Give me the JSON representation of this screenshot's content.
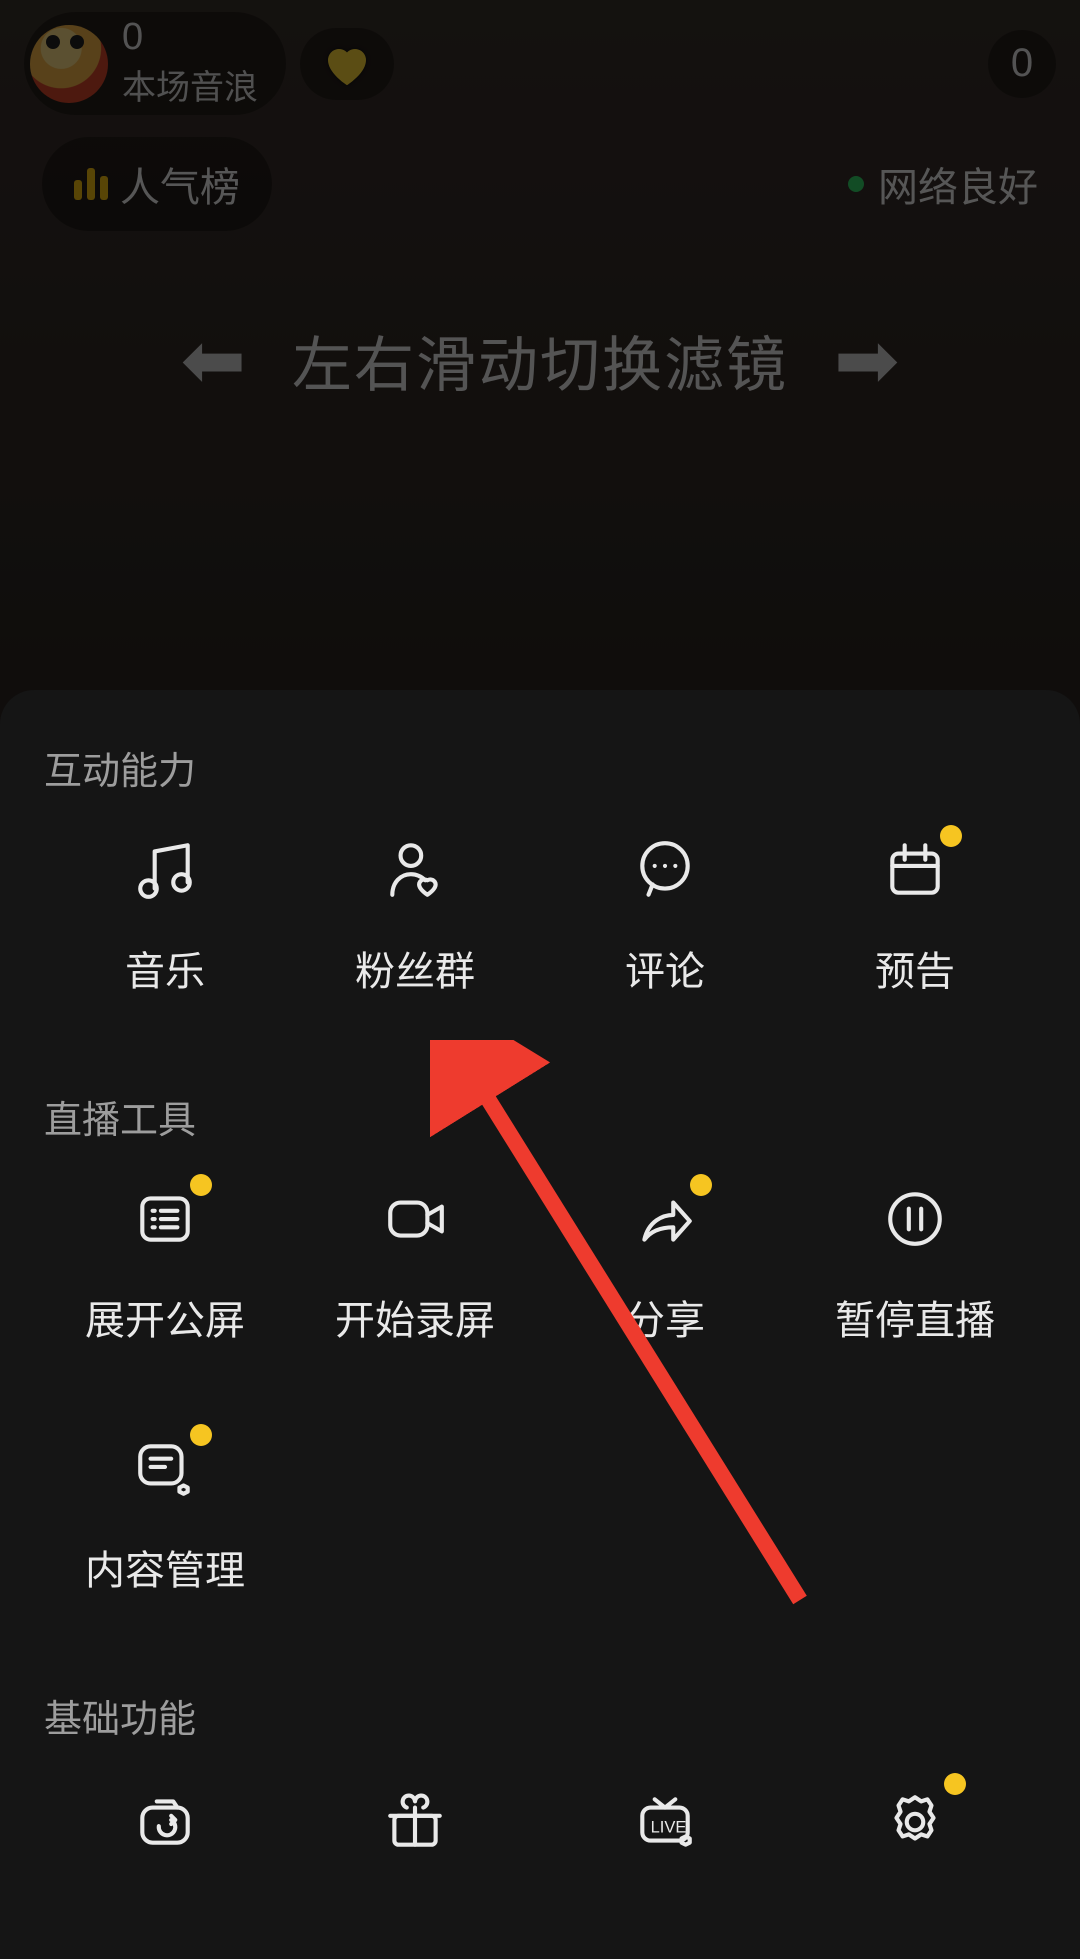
{
  "header": {
    "host_count": "0",
    "host_subtitle": "本场音浪",
    "viewer_count": "0"
  },
  "ranking_chip": "人气榜",
  "network_status": "网络良好",
  "filter_hint": "左右滑动切换滤镜",
  "sections": {
    "interaction": {
      "title": "互动能力",
      "items": [
        "音乐",
        "粉丝群",
        "评论",
        "预告"
      ]
    },
    "tools": {
      "title": "直播工具",
      "items": [
        "展开公屏",
        "开始录屏",
        "分享",
        "暂停直播",
        "内容管理"
      ]
    },
    "basic": {
      "title": "基础功能"
    }
  }
}
